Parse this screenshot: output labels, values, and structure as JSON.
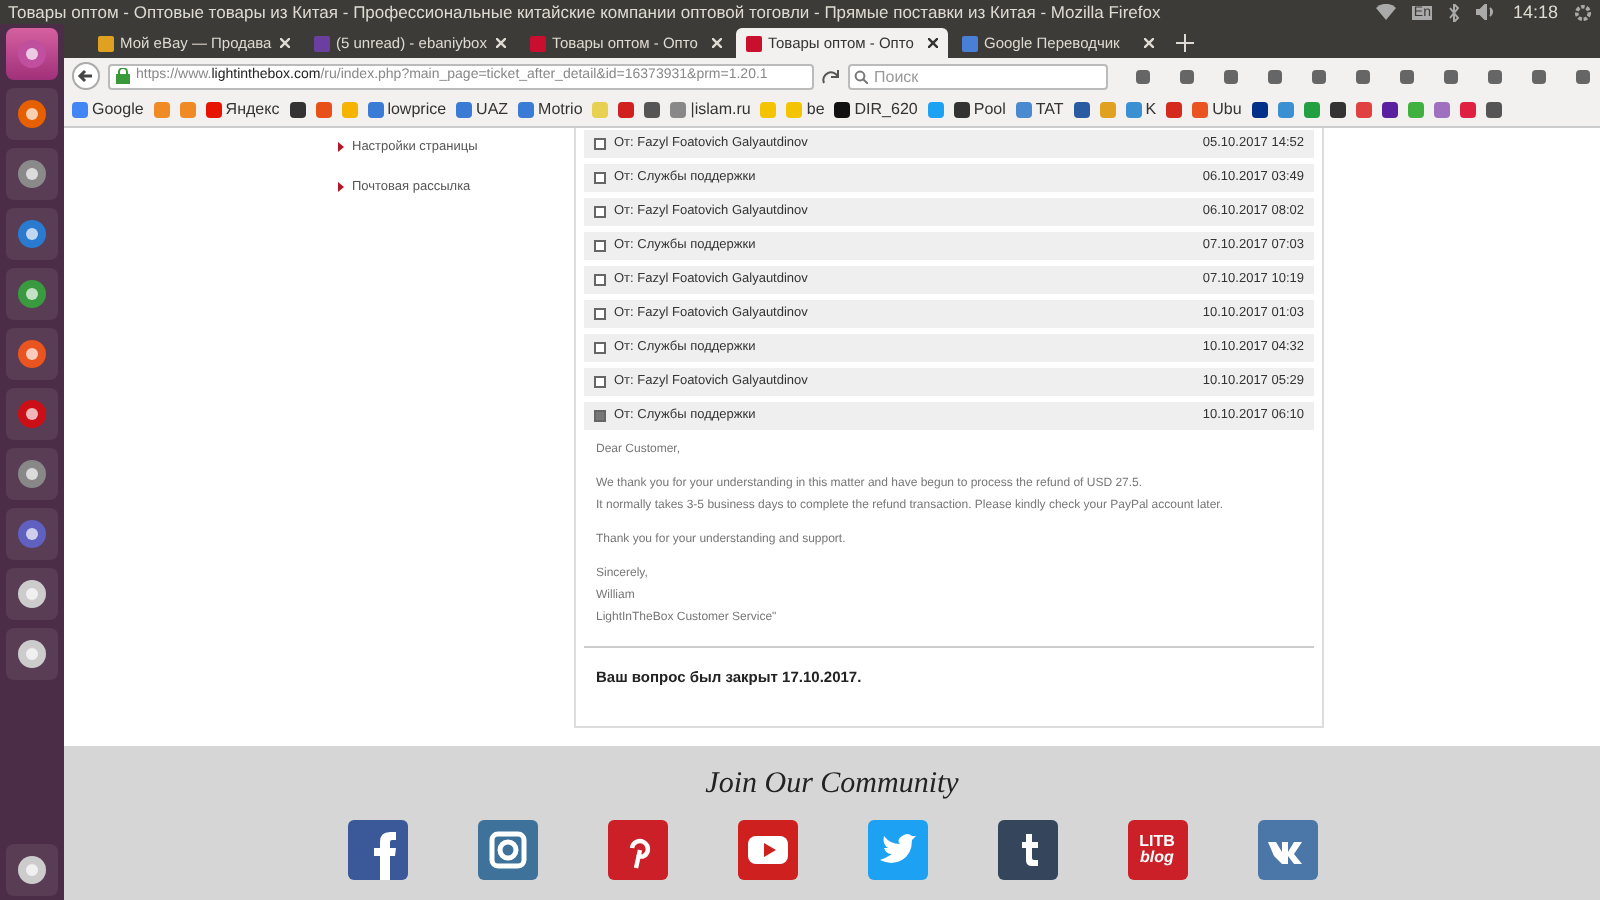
{
  "window": {
    "title": "Товары оптом - Оптовые товары из Китая - Профессиональные китайские компании оптовой тоговли - Прямые поставки из Китая - Mozilla Firefox"
  },
  "tray": {
    "keyboard": "En",
    "clock": "14:18"
  },
  "tabs": [
    {
      "label": "Мой eBay — Продава",
      "selected": false,
      "color": "#e0a020"
    },
    {
      "label": "(5 unread) - ebaniybox",
      "selected": false,
      "color": "#6b3fa0"
    },
    {
      "label": "Товары оптом - Опто",
      "selected": false,
      "color": "#c8102e"
    },
    {
      "label": "Товары оптом - Опто",
      "selected": true,
      "color": "#c8102e"
    },
    {
      "label": "Google Переводчик",
      "selected": false,
      "color": "#4a7fd8"
    }
  ],
  "address_bar": {
    "url_prefix": "https://www.",
    "url_domain": "lightinthebox.com",
    "url_rest": "/ru/index.php?main_page=ticket_after_detail&id=16373931&prm=1.20.1"
  },
  "search": {
    "placeholder": "Поиск"
  },
  "bookmarks": [
    {
      "kind": "label",
      "label": "Google",
      "color": "#4285f4"
    },
    {
      "kind": "icon",
      "color": "#f08a24"
    },
    {
      "kind": "icon",
      "color": "#f08a24"
    },
    {
      "kind": "label",
      "label": "Яндекс",
      "color": "#e61400"
    },
    {
      "kind": "icon",
      "color": "#333333"
    },
    {
      "kind": "icon",
      "color": "#e8501a"
    },
    {
      "kind": "icon",
      "color": "#f5b400"
    },
    {
      "kind": "label",
      "label": "lowprice",
      "color": "#3a7bd5"
    },
    {
      "kind": "label",
      "label": "UAZ",
      "color": "#3a7bd5"
    },
    {
      "kind": "label",
      "label": "Motrio",
      "color": "#3a7bd5"
    },
    {
      "kind": "icon",
      "color": "#e8d050"
    },
    {
      "kind": "icon",
      "color": "#d02020"
    },
    {
      "kind": "icon",
      "color": "#555555"
    },
    {
      "kind": "label",
      "label": "|islam.ru",
      "color": "#888888"
    },
    {
      "kind": "icon",
      "color": "#f5c400"
    },
    {
      "kind": "label",
      "label": "be",
      "color": "#f5c400"
    },
    {
      "kind": "label",
      "label": "DIR_620",
      "color": "#111111"
    },
    {
      "kind": "icon",
      "color": "#1da1f2"
    },
    {
      "kind": "label",
      "label": "Pool",
      "color": "#333333"
    },
    {
      "kind": "label",
      "label": "TAT",
      "color": "#4a8ad0"
    },
    {
      "kind": "icon",
      "color": "#2a5aa0"
    },
    {
      "kind": "icon",
      "color": "#e0a020"
    },
    {
      "kind": "label",
      "label": "K",
      "color": "#3a90d0"
    },
    {
      "kind": "icon",
      "color": "#d52b1e"
    },
    {
      "kind": "label",
      "label": "Ubu",
      "color": "#e95420"
    },
    {
      "kind": "icon",
      "color": "#003087"
    },
    {
      "kind": "icon",
      "color": "#3a90d0"
    },
    {
      "kind": "icon",
      "color": "#20a040"
    },
    {
      "kind": "icon",
      "color": "#333333"
    },
    {
      "kind": "icon",
      "color": "#e04040"
    },
    {
      "kind": "icon",
      "color": "#5a20a0"
    },
    {
      "kind": "icon",
      "color": "#40b040"
    },
    {
      "kind": "icon",
      "color": "#a070c0"
    },
    {
      "kind": "icon",
      "color": "#e02040"
    },
    {
      "kind": "icon",
      "color": "#555555"
    }
  ],
  "sidebar": {
    "items": [
      {
        "label": "Настройки страницы"
      },
      {
        "label": "Почтовая рассылка"
      }
    ]
  },
  "messages": [
    {
      "sender": "От: Fazyl Foatovich Galyautdinov",
      "date": "05.10.2017 14:52",
      "expanded": false
    },
    {
      "sender": "От: Службы поддержки",
      "date": "06.10.2017 03:49",
      "expanded": false
    },
    {
      "sender": "От: Fazyl Foatovich Galyautdinov",
      "date": "06.10.2017 08:02",
      "expanded": false
    },
    {
      "sender": "От: Службы поддержки",
      "date": "07.10.2017 07:03",
      "expanded": false
    },
    {
      "sender": "От: Fazyl Foatovich Galyautdinov",
      "date": "07.10.2017 10:19",
      "expanded": false
    },
    {
      "sender": "От: Fazyl Foatovich Galyautdinov",
      "date": "10.10.2017 01:03",
      "expanded": false
    },
    {
      "sender": "От: Службы поддержки",
      "date": "10.10.2017 04:32",
      "expanded": false
    },
    {
      "sender": "От: Fazyl Foatovich Galyautdinov",
      "date": "10.10.2017 05:29",
      "expanded": false
    },
    {
      "sender": "От: Службы поддержки",
      "date": "10.10.2017 06:10",
      "expanded": true,
      "body": [
        [
          "Dear Customer,"
        ],
        [
          "We thank you for your understanding in this matter and have begun to process the refund of USD 27.5.",
          "It normally takes 3-5 business days to complete the refund transaction. Please kindly check your PayPal account later."
        ],
        [
          "Thank you for your understanding and support."
        ],
        [
          "Sincerely,",
          "William",
          "LightInTheBox Customer Service\""
        ]
      ]
    }
  ],
  "closed_notice": "Ваш вопрос был закрыт 17.10.2017.",
  "footer": {
    "title": "Join Our Community",
    "social": [
      {
        "kind": "facebook"
      },
      {
        "kind": "instagram"
      },
      {
        "kind": "pinterest"
      },
      {
        "kind": "youtube"
      },
      {
        "kind": "twitter"
      },
      {
        "kind": "tumblr"
      },
      {
        "kind": "blog",
        "label": "LITB",
        "sublabel": "blog"
      },
      {
        "kind": "vk"
      }
    ]
  }
}
